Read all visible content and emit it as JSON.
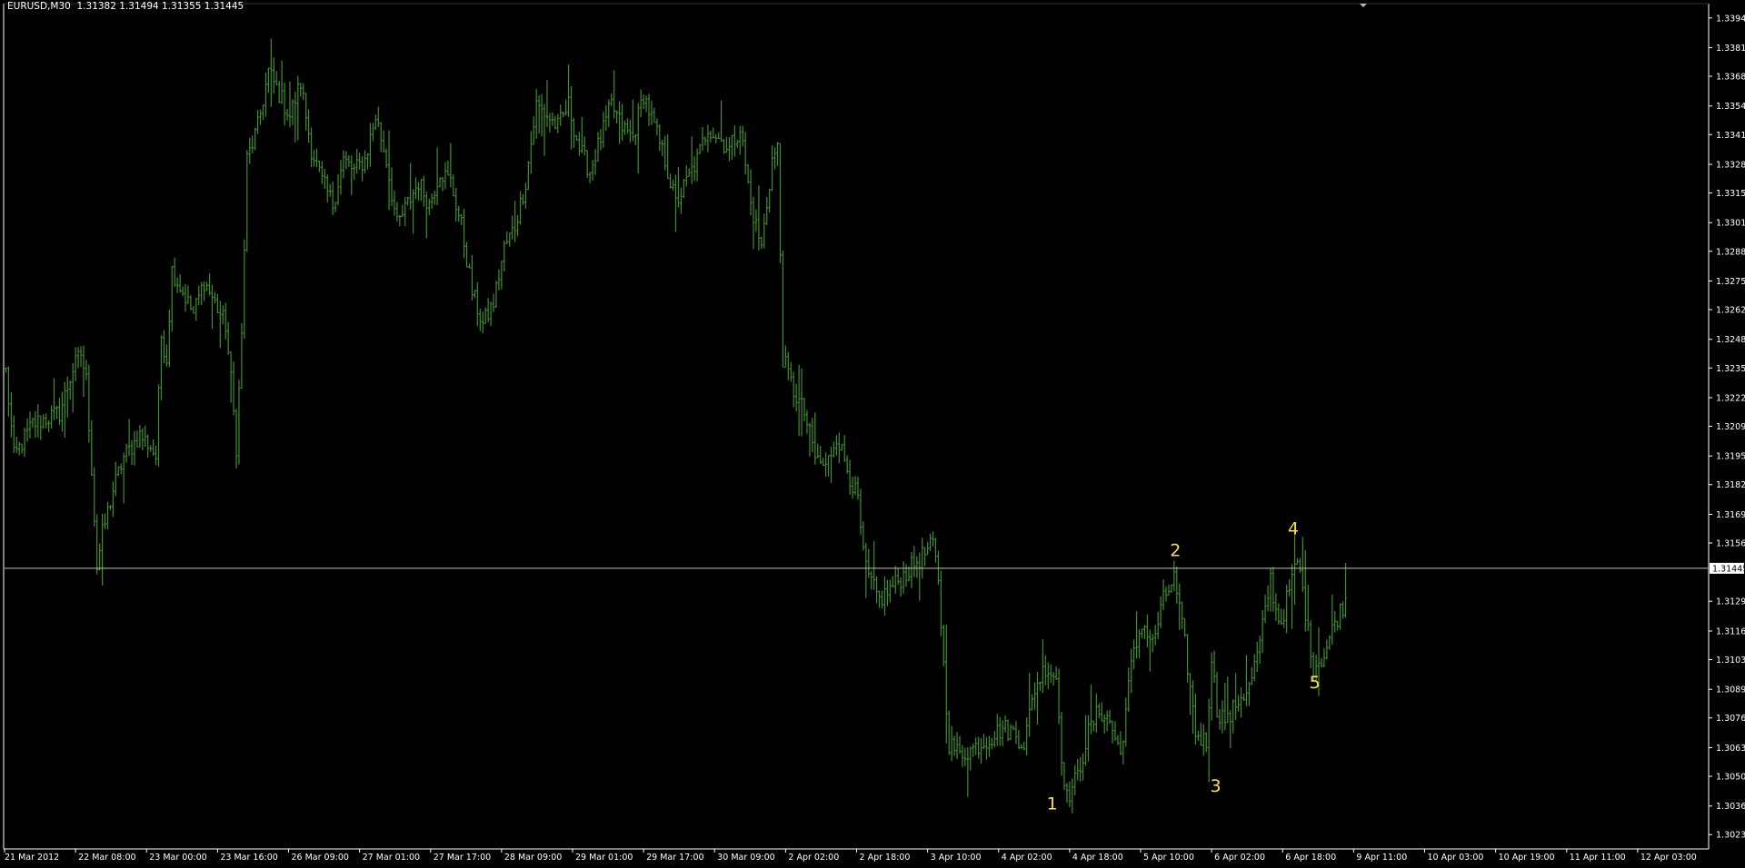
{
  "header": {
    "symbol": "EURUSD,M30",
    "ohlc": "1.31382 1.31494 1.31355 1.31445"
  },
  "colors": {
    "background": "#000000",
    "bars": "#3f8f2c",
    "axis": "#ffffff",
    "price_line": "#c7c3a0",
    "labels": "#ffe033"
  },
  "chart_data": {
    "type": "bar",
    "style": "ohlc",
    "symbol": "EURUSD",
    "timeframe": "M30",
    "current_price": "1.31445",
    "ylim": [
      1.3017,
      1.3401
    ],
    "y_ticks": [
      "1.33945",
      "1.33810",
      "1.33680",
      "1.33545",
      "1.33415",
      "1.33280",
      "1.33150",
      "1.33015",
      "1.32885",
      "1.32750",
      "1.32620",
      "1.32485",
      "1.32355",
      "1.32220",
      "1.32090",
      "1.31955",
      "1.31825",
      "1.31690",
      "1.31560",
      "1.31295",
      "1.31160",
      "1.31030",
      "1.30895",
      "1.30765",
      "1.30630",
      "1.30500",
      "1.30365",
      "1.30235"
    ],
    "x_ticks": [
      "21 Mar 2012",
      "22 Mar 08:00",
      "23 Mar 00:00",
      "23 Mar 16:00",
      "26 Mar 09:00",
      "27 Mar 01:00",
      "27 Mar 17:00",
      "28 Mar 09:00",
      "29 Mar 01:00",
      "29 Mar 17:00",
      "30 Mar 09:00",
      "2 Apr 02:00",
      "2 Apr 18:00",
      "3 Apr 10:00",
      "4 Apr 02:00",
      "4 Apr 18:00",
      "5 Apr 10:00",
      "6 Apr 02:00",
      "6 Apr 18:00",
      "9 Apr 11:00",
      "10 Apr 03:00",
      "10 Apr 19:00",
      "11 Apr 11:00",
      "12 Apr 03:00"
    ],
    "path_points": [
      [
        0,
        1.3234
      ],
      [
        3,
        1.3195
      ],
      [
        10,
        1.321
      ],
      [
        20,
        1.3215
      ],
      [
        25,
        1.3235
      ],
      [
        28,
        1.3242
      ],
      [
        30,
        1.323
      ],
      [
        32,
        1.319
      ],
      [
        34,
        1.3145
      ],
      [
        36,
        1.316
      ],
      [
        40,
        1.318
      ],
      [
        44,
        1.3195
      ],
      [
        50,
        1.3205
      ],
      [
        54,
        1.32
      ],
      [
        56,
        1.3195
      ],
      [
        58,
        1.325
      ],
      [
        60,
        1.324
      ],
      [
        62,
        1.328
      ],
      [
        66,
        1.327
      ],
      [
        70,
        1.326
      ],
      [
        74,
        1.3275
      ],
      [
        78,
        1.3265
      ],
      [
        82,
        1.3255
      ],
      [
        84,
        1.323
      ],
      [
        86,
        1.32
      ],
      [
        88,
        1.325
      ],
      [
        90,
        1.333
      ],
      [
        94,
        1.3345
      ],
      [
        98,
        1.337
      ],
      [
        102,
        1.336
      ],
      [
        106,
        1.335
      ],
      [
        110,
        1.3365
      ],
      [
        114,
        1.3335
      ],
      [
        118,
        1.332
      ],
      [
        122,
        1.331
      ],
      [
        126,
        1.333
      ],
      [
        130,
        1.3325
      ],
      [
        134,
        1.333
      ],
      [
        138,
        1.335
      ],
      [
        142,
        1.333
      ],
      [
        146,
        1.33
      ],
      [
        150,
        1.331
      ],
      [
        154,
        1.332
      ],
      [
        158,
        1.331
      ],
      [
        162,
        1.3325
      ],
      [
        166,
        1.332
      ],
      [
        170,
        1.33
      ],
      [
        174,
        1.327
      ],
      [
        178,
        1.3255
      ],
      [
        182,
        1.3265
      ],
      [
        186,
        1.329
      ],
      [
        190,
        1.33
      ],
      [
        194,
        1.332
      ],
      [
        198,
        1.3355
      ],
      [
        202,
        1.335
      ],
      [
        206,
        1.3345
      ],
      [
        210,
        1.3355
      ],
      [
        214,
        1.3335
      ],
      [
        218,
        1.3325
      ],
      [
        222,
        1.334
      ],
      [
        226,
        1.3355
      ],
      [
        230,
        1.3345
      ],
      [
        234,
        1.334
      ],
      [
        238,
        1.336
      ],
      [
        242,
        1.3345
      ],
      [
        246,
        1.333
      ],
      [
        250,
        1.331
      ],
      [
        254,
        1.332
      ],
      [
        258,
        1.333
      ],
      [
        262,
        1.3345
      ],
      [
        266,
        1.334
      ],
      [
        270,
        1.3335
      ],
      [
        274,
        1.3345
      ],
      [
        278,
        1.331
      ],
      [
        282,
        1.329
      ],
      [
        286,
        1.333
      ],
      [
        288,
        1.3335
      ],
      [
        290,
        1.324
      ],
      [
        294,
        1.3225
      ],
      [
        298,
        1.3215
      ],
      [
        302,
        1.3195
      ],
      [
        306,
        1.319
      ],
      [
        310,
        1.3205
      ],
      [
        314,
        1.319
      ],
      [
        318,
        1.3175
      ],
      [
        320,
        1.315
      ],
      [
        322,
        1.314
      ],
      [
        326,
        1.313
      ],
      [
        330,
        1.3135
      ],
      [
        334,
        1.314
      ],
      [
        338,
        1.3145
      ],
      [
        342,
        1.315
      ],
      [
        346,
        1.3155
      ],
      [
        348,
        1.314
      ],
      [
        350,
        1.31
      ],
      [
        352,
        1.3065
      ],
      [
        356,
        1.306
      ],
      [
        360,
        1.3062
      ],
      [
        364,
        1.3065
      ],
      [
        368,
        1.3068
      ],
      [
        372,
        1.3072
      ],
      [
        376,
        1.307
      ],
      [
        380,
        1.3065
      ],
      [
        384,
        1.309
      ],
      [
        388,
        1.31
      ],
      [
        392,
        1.3095
      ],
      [
        394,
        1.306
      ],
      [
        396,
        1.304
      ],
      [
        400,
        1.305
      ],
      [
        404,
        1.307
      ],
      [
        408,
        1.308
      ],
      [
        412,
        1.3075
      ],
      [
        416,
        1.306
      ],
      [
        420,
        1.31
      ],
      [
        424,
        1.312
      ],
      [
        428,
        1.311
      ],
      [
        432,
        1.313
      ],
      [
        436,
        1.314
      ],
      [
        440,
        1.311
      ],
      [
        444,
        1.307
      ],
      [
        448,
        1.3065
      ],
      [
        450,
        1.3105
      ],
      [
        452,
        1.308
      ],
      [
        456,
        1.3075
      ],
      [
        460,
        1.3085
      ],
      [
        464,
        1.309
      ],
      [
        468,
        1.311
      ],
      [
        472,
        1.314
      ],
      [
        474,
        1.3125
      ],
      [
        476,
        1.312
      ],
      [
        478,
        1.313
      ],
      [
        482,
        1.3148
      ],
      [
        484,
        1.3135
      ],
      [
        486,
        1.3115
      ],
      [
        488,
        1.31
      ],
      [
        492,
        1.3105
      ],
      [
        496,
        1.312
      ],
      [
        500,
        1.313
      ]
    ],
    "annotations": [
      {
        "label": "1",
        "x": 391,
        "price": 1.3035
      },
      {
        "label": "2",
        "x": 437,
        "price": 1.315
      },
      {
        "label": "3",
        "x": 452,
        "price": 1.3043
      },
      {
        "label": "4",
        "x": 481,
        "price": 1.316
      },
      {
        "label": "5",
        "x": 489,
        "price": 1.309
      }
    ],
    "xmax": 636,
    "grid": false,
    "legend": "none"
  }
}
